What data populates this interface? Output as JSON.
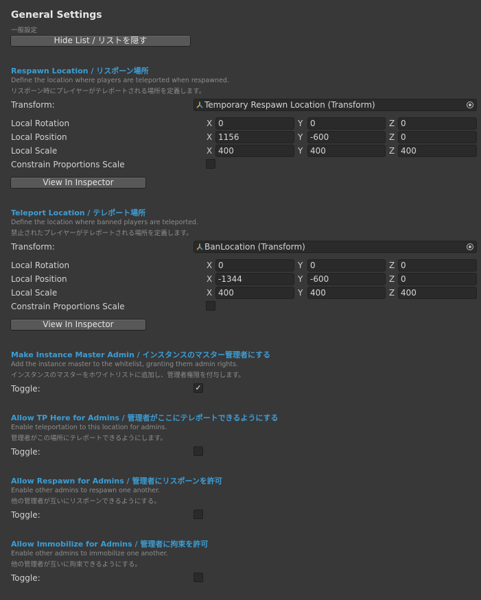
{
  "header": {
    "title": "General Settings",
    "subtitle": "一般設定",
    "hide_list_label": "Hide List / リストを隠す"
  },
  "respawn": {
    "heading": "Respawn Location / リスポーン場所",
    "desc_en": "Define the location where players are teleported when respawned.",
    "desc_jp": "リスポーン時にプレイヤーがテレポートされる場所を定義します。",
    "transform_label": "Transform:",
    "transform_value": "Temporary Respawn Location (Transform)",
    "rotation_label": "Local Rotation",
    "position_label": "Local Position",
    "scale_label": "Local Scale",
    "constrain_label": "Constrain Proportions Scale",
    "rotation": {
      "x": "0",
      "y": "0",
      "z": "0"
    },
    "position": {
      "x": "1156",
      "y": "-600",
      "z": "0"
    },
    "scale": {
      "x": "400",
      "y": "400",
      "z": "400"
    },
    "view_button": "View In Inspector"
  },
  "teleport": {
    "heading": "Teleport Location / テレポート場所",
    "desc_en": "Define the location where banned players are teleported.",
    "desc_jp": "禁止されたプレイヤーがテレポートされる場所を定義します。",
    "transform_label": "Transform:",
    "transform_value": "BanLocation (Transform)",
    "rotation_label": "Local Rotation",
    "position_label": "Local Position",
    "scale_label": "Local Scale",
    "constrain_label": "Constrain Proportions Scale",
    "rotation": {
      "x": "0",
      "y": "0",
      "z": "0"
    },
    "position": {
      "x": "-1344",
      "y": "-600",
      "z": "0"
    },
    "scale": {
      "x": "400",
      "y": "400",
      "z": "400"
    },
    "view_button": "View In Inspector"
  },
  "axes": {
    "x": "X",
    "y": "Y",
    "z": "Z"
  },
  "master_admin": {
    "heading": "Make Instance Master Admin / インスタンスのマスター管理者にする",
    "desc_en": "Add the instance master to the whitelist, granting them admin rights.",
    "desc_jp": "インスタンスのマスターをホワイトリストに追加し、管理者権限を付与します。",
    "toggle_label": "Toggle:",
    "check_mark": "✓",
    "checked": true
  },
  "tp_here": {
    "heading": "Allow TP Here for Admins / 管理者がここにテレポートできるようにする",
    "desc_en": "Enable teleportation to this location for admins.",
    "desc_jp": "管理者がこの場所にテレポートできるようにします。",
    "toggle_label": "Toggle:",
    "checked": false
  },
  "respawn_admins": {
    "heading": "Allow Respawn for Admins / 管理者にリスポーンを許可",
    "desc_en": "Enable other admins to respawn one another.",
    "desc_jp": "他の管理者が互いにリスポーンできるようにする。",
    "toggle_label": "Toggle:",
    "checked": false
  },
  "immobilize_admins": {
    "heading": "Allow Immobilize for Admins / 管理者に拘束を許可",
    "desc_en": "Enable other admins to immobilize one another.",
    "desc_jp": "他の管理者が互いに拘束できるようにする。",
    "toggle_label": "Toggle:",
    "checked": false
  },
  "colors": {
    "background": "#383838",
    "accent": "#3c9ed6",
    "field": "#2a2a2a"
  }
}
